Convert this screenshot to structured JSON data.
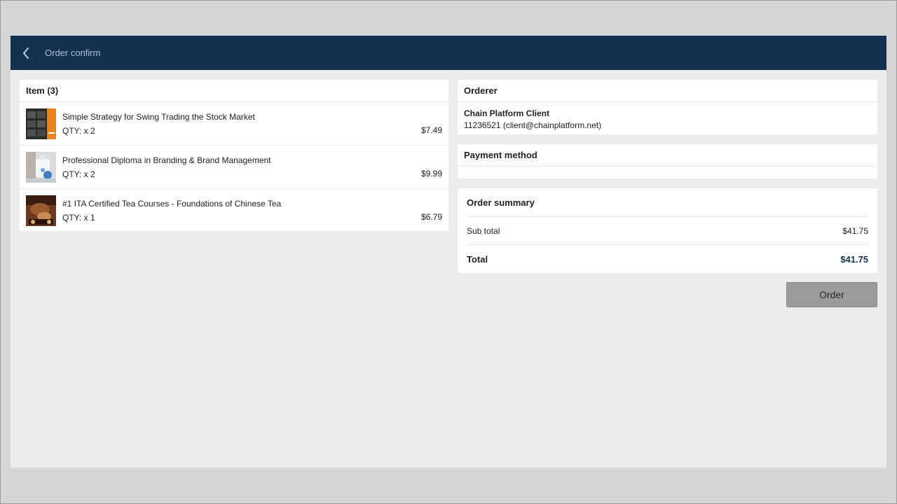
{
  "header": {
    "title": "Order confirm",
    "back_icon": "chevron-left-icon"
  },
  "items": {
    "heading": "Item (3)",
    "list": [
      {
        "name": "Simple Strategy for Swing Trading the Stock Market",
        "qty": "QTY: x 2",
        "price": "$7.49",
        "thumb": "book-thumbnail"
      },
      {
        "name": "Professional Diploma in Branding & Brand Management",
        "qty": "QTY: x 2",
        "price": "$9.99",
        "thumb": "product-thumbnail"
      },
      {
        "name": "#1 ITA Certified Tea Courses - Foundations of Chinese Tea",
        "qty": "QTY: x 1",
        "price": "$6.79",
        "thumb": "tea-thumbnail"
      }
    ]
  },
  "orderer": {
    "heading": "Orderer",
    "name": "Chain Platform Client",
    "contact": "11236521 (client@chainplatform.net)"
  },
  "payment": {
    "heading": "Payment method"
  },
  "summary": {
    "heading": "Order summary",
    "subtotal_label": "Sub total",
    "subtotal_value": "$41.75",
    "total_label": "Total",
    "total_value": "$41.75"
  },
  "actions": {
    "order_label": "Order"
  },
  "colors": {
    "header_bg": "#14324f",
    "accent": "#14324f",
    "button_bg": "#9b9b9b"
  }
}
